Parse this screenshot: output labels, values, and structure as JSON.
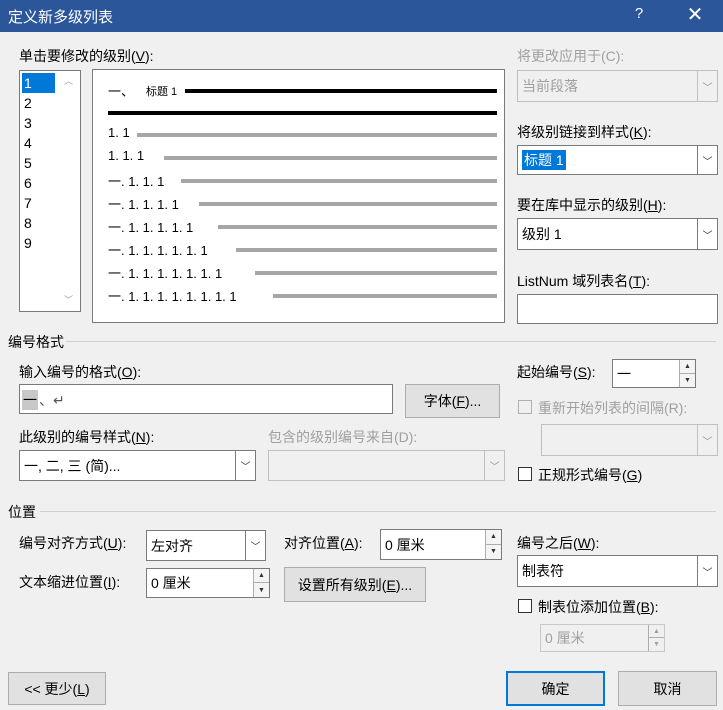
{
  "window": {
    "title": "定义新多级列表",
    "help": "?",
    "close": "✕"
  },
  "level_list": {
    "label": "单击要修改的级别(",
    "label_key": "V",
    "label_end": "):",
    "items": [
      "1",
      "2",
      "3",
      "4",
      "5",
      "6",
      "7",
      "8",
      "9"
    ],
    "selected": "1"
  },
  "preview": {
    "rows": [
      {
        "prefix": "一、",
        "heading": "标题 1"
      },
      {
        "prefix": "1. 1"
      },
      {
        "prefix": "1. 1. 1"
      },
      {
        "prefix": "一. 1. 1. 1"
      },
      {
        "prefix": "一. 1. 1. 1. 1"
      },
      {
        "prefix": "一. 1. 1. 1. 1. 1"
      },
      {
        "prefix": "一. 1. 1. 1. 1. 1. 1"
      },
      {
        "prefix": "一. 1. 1. 1. 1. 1. 1. 1"
      },
      {
        "prefix": "一. 1. 1. 1. 1. 1. 1. 1. 1"
      }
    ]
  },
  "apply_to": {
    "label": "将更改应用于(C):",
    "value": "当前段落"
  },
  "link_style": {
    "label": "将级别链接到样式(",
    "key": "K",
    "end": "):",
    "value": "标题 1"
  },
  "gallery_level": {
    "label": "要在库中显示的级别(",
    "key": "H",
    "end": "):",
    "value": "级别 1"
  },
  "listnum": {
    "label": "ListNum 域列表名(",
    "key": "T",
    "end": "):",
    "value": ""
  },
  "number_format": {
    "section": "编号格式",
    "format_label": "输入编号的格式(",
    "format_key": "O",
    "format_end": "):",
    "format_number": "一",
    "format_rest": "、↵",
    "font_btn": "字体(",
    "font_key": "F",
    "font_end": ")...",
    "style_label": "此级别的编号样式(",
    "style_key": "N",
    "style_end": "):",
    "style_value": "一, 二, 三 (简)...",
    "include_label": "包含的级别编号来自(D):",
    "include_value": "",
    "start_label": "起始编号(",
    "start_key": "S",
    "start_end": "):",
    "start_value": "一",
    "restart_label": "重新开始列表的间隔(R):",
    "restart_value": "",
    "legal_label": "正规形式编号(",
    "legal_key": "G",
    "legal_end": ")"
  },
  "position": {
    "section": "位置",
    "align_label": "编号对齐方式(",
    "align_key": "U",
    "align_end": "):",
    "align_value": "左对齐",
    "align_at_label": "对齐位置(",
    "align_at_key": "A",
    "align_at_end": "):",
    "align_at_value": "0 厘米",
    "indent_label": "文本缩进位置(",
    "indent_key": "I",
    "indent_end": "):",
    "indent_value": "0 厘米",
    "set_all_btn": "设置所有级别(",
    "set_all_key": "E",
    "set_all_end": ")...",
    "follow_label": "编号之后(",
    "follow_key": "W",
    "follow_end": "):",
    "follow_value": "制表符",
    "tab_add_label": "制表位添加位置(",
    "tab_add_key": "B",
    "tab_add_end": "):",
    "tab_add_value": "0 厘米"
  },
  "footer": {
    "less_btn": "<< 更少(",
    "less_key": "L",
    "less_end": ")",
    "ok": "确定",
    "cancel": "取消"
  }
}
